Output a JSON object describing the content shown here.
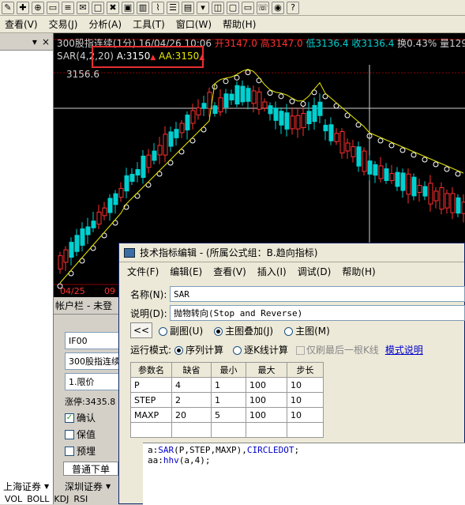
{
  "toolbar": {
    "icons": [
      "edit-icon",
      "crosshair-icon",
      "zoom-icon",
      "window-icon",
      "list-icon",
      "notes-icon",
      "blank-icon",
      "disconnect-icon",
      "image-icon",
      "bar-chart-icon",
      "line-chart-icon",
      "checklist-icon",
      "bars-icon",
      "menu-icon",
      "stack-icon",
      "monitor-icon",
      "folder-icon",
      "phone-icon",
      "shield-icon",
      "help-icon"
    ]
  },
  "menubar": {
    "items": [
      "查看(V)",
      "交易(J)",
      "分析(A)",
      "工具(T)",
      "窗口(W)",
      "帮助(H)"
    ]
  },
  "chart": {
    "title_prefix": "300股指连续(1分)",
    "title_time": "16/04/26 10:06",
    "open": "开3147.0",
    "high": "高3147.0",
    "low": "低3136.4",
    "close": "收3136.4",
    "turnover": "换0.43%",
    "volume": "量129",
    "indicator": "SAR(4,2,20)",
    "a_value": "A:3150",
    "aa_value": "AA:3150",
    "price_label": "3156.6",
    "date_label": "04/25",
    "date_label2": "09",
    "colors": {
      "up": "#ff3030",
      "down": "#00d0d0",
      "sar": "#ffffff",
      "aa": "#e8e800",
      "grid": "#8b0000"
    }
  },
  "leftpane": {
    "header_x": "×"
  },
  "account": {
    "header": "帐户栏",
    "header_extra": "- 未登",
    "contract": "IF00",
    "name": "300股指连续",
    "order_type": "1.限价",
    "limit": "涨停:3435.8",
    "checkboxes": [
      {
        "label": "确认",
        "checked": true
      },
      {
        "label": "保值",
        "checked": false
      },
      {
        "label": "预埋",
        "checked": false
      }
    ],
    "tab_order": "普通下单",
    "tab_market1": "上海证券",
    "tab_market2": "深圳证券",
    "bottom_tabs": [
      "VOL",
      "BOLL",
      "KDJ",
      "RSI"
    ]
  },
  "dialog": {
    "title": "技术指标编辑 - (所属公式组：B.趋向指标)",
    "menu": [
      "文件(F)",
      "编辑(E)",
      "查看(V)",
      "插入(I)",
      "调试(D)",
      "帮助(H)"
    ],
    "name_label": "名称(N):",
    "name_value": "SAR",
    "desc_label": "说明(D):",
    "desc_value": "抛物转向(Stop and Reverse)",
    "nav_button": "<<",
    "radios": [
      {
        "label": "副图(U)",
        "on": false
      },
      {
        "label": "主图叠加(J)",
        "on": true
      },
      {
        "label": "主图(M)",
        "on": false
      }
    ],
    "mode_label": "运行模式:",
    "mode_options": [
      {
        "label": "序列计算",
        "on": true
      },
      {
        "label": "逐K线计算",
        "on": false
      }
    ],
    "last_bar_label": "仅刷最后一根K线",
    "mode_help": "模式说明",
    "param_headers": [
      "参数名",
      "缺省",
      "最小",
      "最大",
      "步长"
    ],
    "params": [
      [
        "P",
        "4",
        "1",
        "100",
        "10"
      ],
      [
        "STEP",
        "2",
        "1",
        "100",
        "10"
      ],
      [
        "MAXP",
        "20",
        "5",
        "100",
        "10"
      ]
    ],
    "code_line1_a": "a:",
    "code_line1_b": "SAR",
    "code_line1_c": "(P,STEP,MAXP),",
    "code_line1_d": "CIRCLEDOT",
    "code_line1_e": ";",
    "code_line2_a": "aa:",
    "code_line2_b": "hhv",
    "code_line2_c": "(a,4);"
  }
}
